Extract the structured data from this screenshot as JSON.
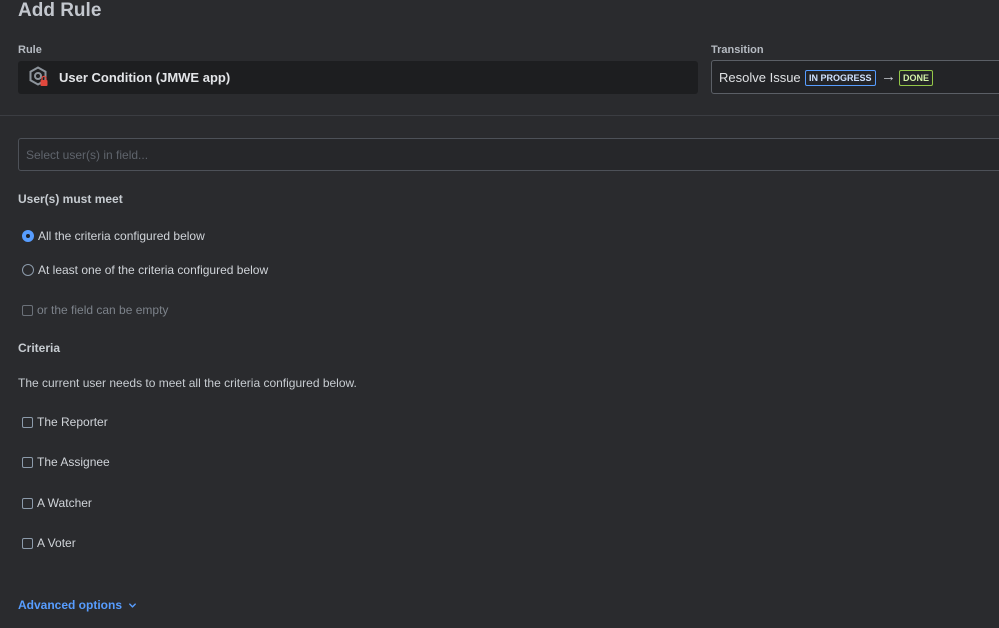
{
  "page": {
    "title": "Add Rule"
  },
  "rule": {
    "label": "Rule",
    "value": "User Condition (JMWE app)",
    "icon": "gear-lock-icon"
  },
  "transition": {
    "label": "Transition",
    "name": "Resolve Issue",
    "from_status": "IN PROGRESS",
    "arrow": "→",
    "to_status": "DONE"
  },
  "user_field": {
    "placeholder": "Select user(s) in field..."
  },
  "must_meet": {
    "heading": "User(s) must meet",
    "options": [
      {
        "label": "All the criteria configured below",
        "selected": true
      },
      {
        "label": "At least one of the criteria configured below",
        "selected": false
      }
    ],
    "empty_option": "or the field can be empty"
  },
  "criteria": {
    "heading": "Criteria",
    "description": "The current user needs to meet all the criteria configured below.",
    "items": [
      {
        "label": "The Reporter"
      },
      {
        "label": "The Assignee"
      },
      {
        "label": "A Watcher"
      },
      {
        "label": "A Voter"
      }
    ]
  },
  "advanced": {
    "label": "Advanced options"
  },
  "colors": {
    "background": "#2a2b2e",
    "accent": "#579dff",
    "in_progress": "#579dff",
    "done": "#94c748",
    "lock_red": "#e2483d"
  }
}
